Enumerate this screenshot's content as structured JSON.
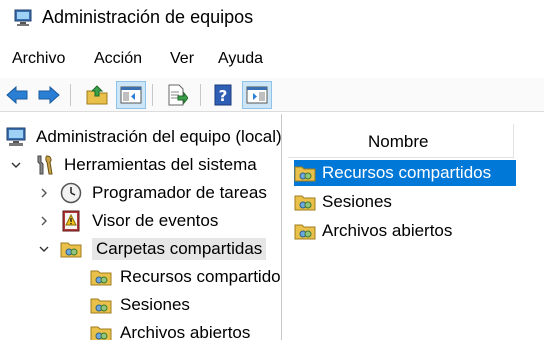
{
  "window": {
    "title": "Administración de equipos",
    "icon": "computer-management-icon"
  },
  "menu": {
    "items": [
      "Archivo",
      "Acción",
      "Ver",
      "Ayuda"
    ]
  },
  "toolbar": {
    "buttons": [
      "back-arrow-icon",
      "forward-arrow-icon",
      "up-folder-icon",
      "show-hide-console-tree-icon",
      "export-list-icon",
      "help-icon",
      "show-hide-action-pane-icon"
    ]
  },
  "tree": {
    "root": "Administración del equipo (local)",
    "tools": "Herramientas del sistema",
    "scheduler": "Programador de tareas",
    "eventviewer": "Visor de eventos",
    "shared": "Carpetas compartidas",
    "shares": "Recursos compartidos",
    "sessions": "Sesiones",
    "openfiles": "Archivos abiertos"
  },
  "list": {
    "column_name": "Nombre",
    "items": [
      "Recursos compartidos",
      "Sesiones",
      "Archivos abiertos"
    ],
    "selected_index": 0
  },
  "colors": {
    "selection": "#0078d7",
    "arrow_blue": "#2a7fd4"
  }
}
